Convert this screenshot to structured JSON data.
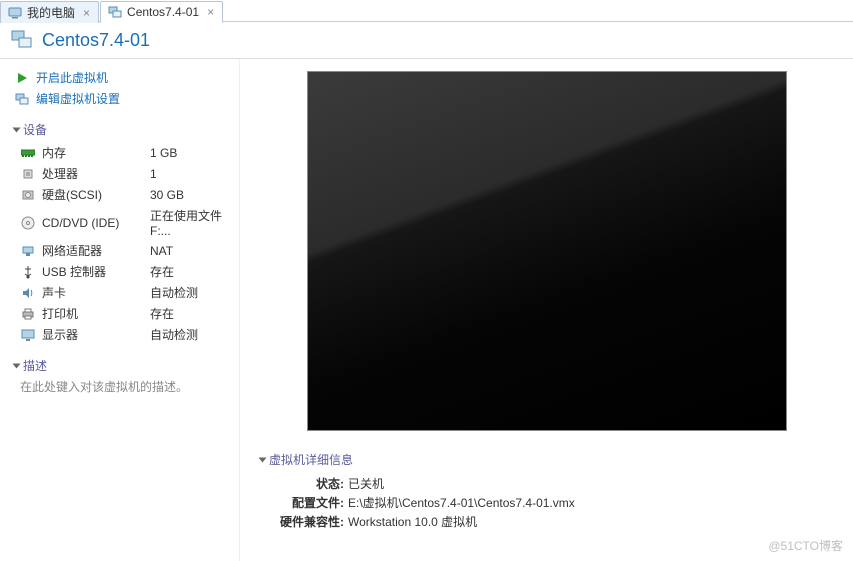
{
  "tabs": [
    {
      "label": "我的电脑"
    },
    {
      "label": "Centos7.4-01"
    }
  ],
  "header": {
    "title": "Centos7.4-01"
  },
  "actions": {
    "power_on": "开启此虚拟机",
    "edit_settings": "编辑虚拟机设置"
  },
  "sections": {
    "devices": "设备",
    "description": "描述",
    "details": "虚拟机详细信息"
  },
  "devices": {
    "memory": {
      "label": "内存",
      "value": "1 GB"
    },
    "cpu": {
      "label": "处理器",
      "value": "1"
    },
    "disk": {
      "label": "硬盘(SCSI)",
      "value": "30 GB"
    },
    "cd": {
      "label": "CD/DVD (IDE)",
      "value": "正在使用文件 F:..."
    },
    "net": {
      "label": "网络适配器",
      "value": "NAT"
    },
    "usb": {
      "label": "USB 控制器",
      "value": "存在"
    },
    "sound": {
      "label": "声卡",
      "value": "自动检测"
    },
    "printer": {
      "label": "打印机",
      "value": "存在"
    },
    "display": {
      "label": "显示器",
      "value": "自动检测"
    }
  },
  "description_placeholder": "在此处键入对该虚拟机的描述。",
  "details": {
    "state": {
      "label": "状态:",
      "value": "已关机"
    },
    "config": {
      "label": "配置文件:",
      "value": "E:\\虚拟机\\Centos7.4-01\\Centos7.4-01.vmx"
    },
    "compat": {
      "label": "硬件兼容性:",
      "value": "Workstation 10.0 虚拟机"
    }
  },
  "watermark": "@51CTO博客"
}
